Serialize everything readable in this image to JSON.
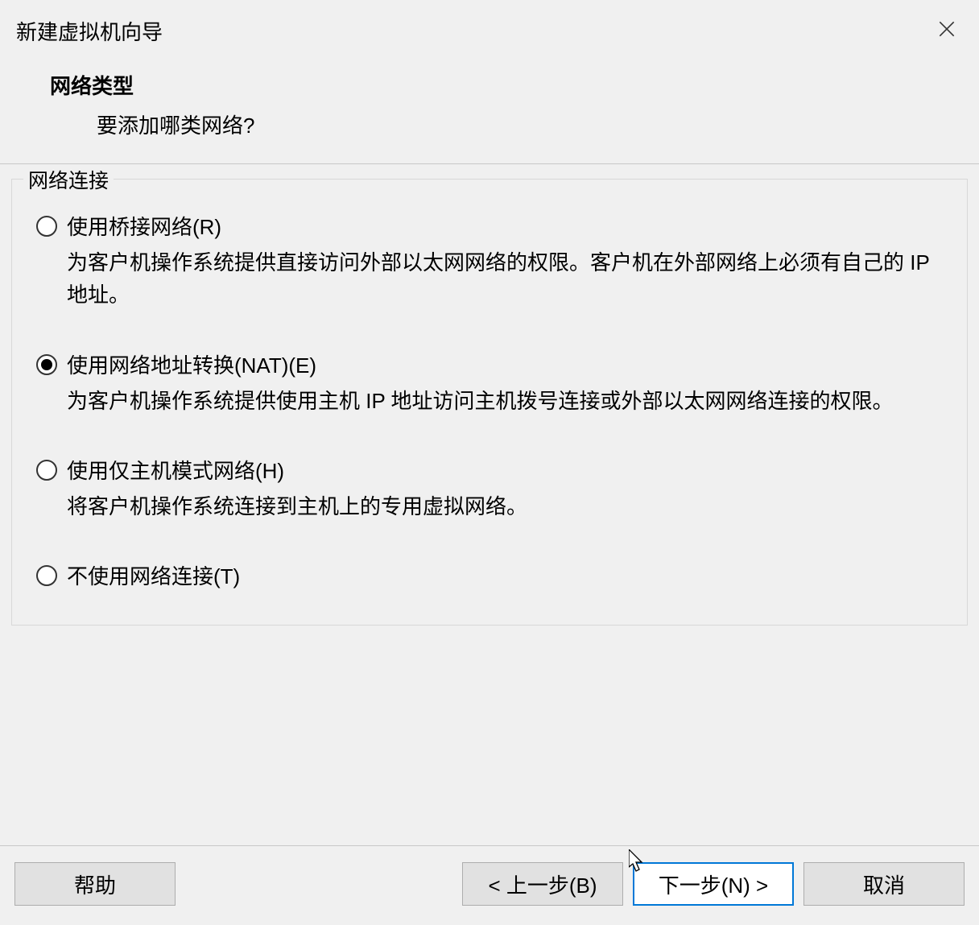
{
  "wizard": {
    "title": "新建虚拟机向导",
    "page_title": "网络类型",
    "page_subtitle": "要添加哪类网络?"
  },
  "group": {
    "legend": "网络连接"
  },
  "options": {
    "bridged": {
      "label": "使用桥接网络(R)",
      "desc": "为客户机操作系统提供直接访问外部以太网网络的权限。客户机在外部网络上必须有自己的 IP 地址。",
      "checked": false
    },
    "nat": {
      "label": "使用网络地址转换(NAT)(E)",
      "desc": "为客户机操作系统提供使用主机 IP 地址访问主机拨号连接或外部以太网网络连接的权限。",
      "checked": true
    },
    "hostonly": {
      "label": "使用仅主机模式网络(H)",
      "desc": "将客户机操作系统连接到主机上的专用虚拟网络。",
      "checked": false
    },
    "none": {
      "label": "不使用网络连接(T)",
      "desc": "",
      "checked": false
    }
  },
  "buttons": {
    "help": "帮助",
    "back": "< 上一步(B)",
    "next": "下一步(N) >",
    "cancel": "取消"
  }
}
